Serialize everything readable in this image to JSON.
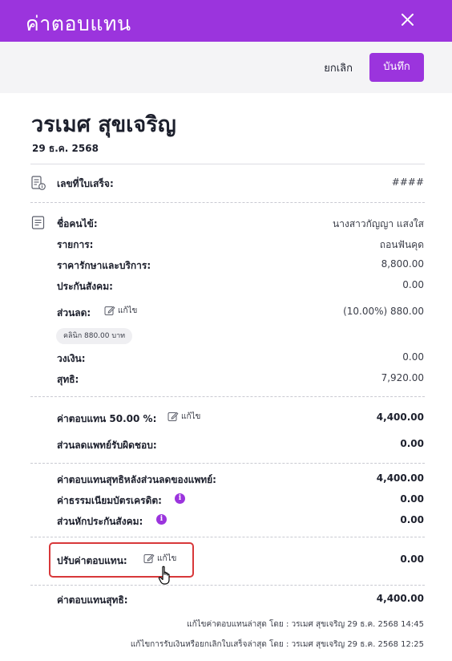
{
  "header": {
    "title": "ค่าตอบแทน"
  },
  "toolbar": {
    "cancel_label": "ยกเลิก",
    "save_label": "บันทึก"
  },
  "doctor": {
    "name": "วรเมศ สุขเจริญ",
    "date": "29 ธ.ค. 2568"
  },
  "receipt": {
    "label": "เลขที่ใบเสร็จ:",
    "value": "####"
  },
  "details": {
    "patient_label": "ชื่อคนไข้:",
    "patient_value": "นางสาวกัญญา แสงใส",
    "item_label": "รายการ:",
    "item_value": "ถอนฟันคุด",
    "price_label": "ราคารักษาและบริการ:",
    "price_value": "8,800.00",
    "social_label": "ประกันสังคม:",
    "social_value": "0.00",
    "discount_label": "ส่วนลด:",
    "discount_edit": "แก้ไข",
    "discount_value": "(10.00%) 880.00",
    "clinic_chip": "คลินิก 880.00 บาท",
    "limit_label": "วงเงิน:",
    "limit_value": "0.00",
    "net_label": "สุทธิ:",
    "net_value": "7,920.00"
  },
  "fee": {
    "fee_label": "ค่าตอบแทน 50.00 %:",
    "fee_edit": "แก้ไข",
    "fee_value": "4,400.00",
    "doctor_discount_label": "ส่วนลดแพทย์รับผิดชอบ:",
    "doctor_discount_value": "0.00"
  },
  "deductions": {
    "after_discount_label": "ค่าตอบแทนสุทธิหลังส่วนลดของแพทย์:",
    "after_discount_value": "4,400.00",
    "card_fee_label": "ค่าธรรมเนียมบัตรเครดิต:",
    "card_fee_value": "0.00",
    "social_deduct_label": "ส่วนหักประกันสังคม:",
    "social_deduct_value": "0.00"
  },
  "adjust": {
    "label": "ปรับค่าตอบแทน:",
    "edit": "แก้ไข",
    "value": "0.00"
  },
  "total": {
    "label": "ค่าตอบแทนสุทธิ:",
    "value": "4,400.00"
  },
  "footer": {
    "last_edit": "แก้ไขค่าตอบแทนล่าสุด โดย : วรเมศ สุขเจริญ 29 ธ.ค. 2568 14:45",
    "last_payment_edit": "แก้ไขการรับเงินหรือยกเลิกใบเสร็จล่าสุด โดย : วรเมศ สุขเจริญ 29 ธ.ค. 2568 12:25"
  },
  "colors": {
    "accent": "#9b34dd",
    "highlight": "#d8383a"
  }
}
